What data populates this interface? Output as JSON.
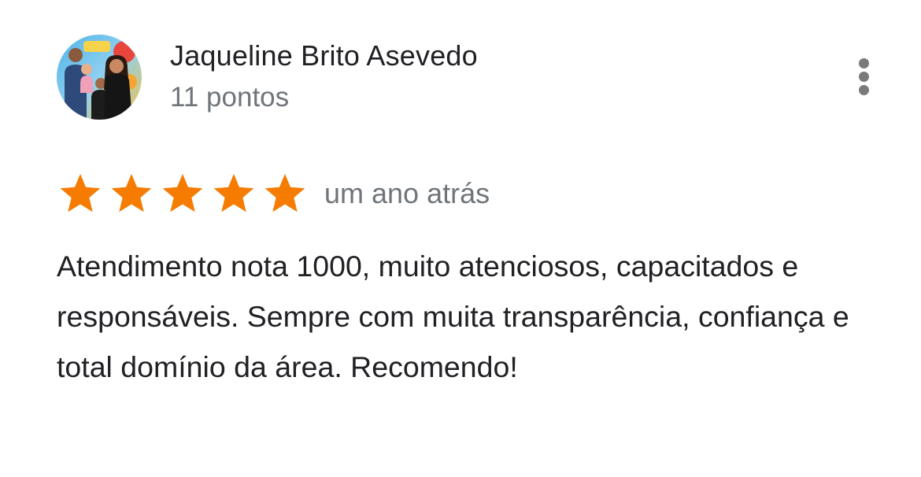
{
  "review": {
    "reviewer_name": "Jaqueline Brito Asevedo",
    "reviewer_points": "11 pontos",
    "rating": 5,
    "rating_max": 5,
    "date": "um ano atrás",
    "text": "Atendimento nota 1000, muito atenciosos, capacitados e responsáveis. Sempre com muita transparência, confiança e total domínio da área. Recomendo!"
  },
  "icons": {
    "star": "star-icon",
    "more": "more-vert-icon",
    "avatar": "avatar-photo"
  },
  "colors": {
    "star": "#f57c00",
    "name": "#202124",
    "secondary": "#70757a",
    "body_text": "#202124",
    "menu_dots": "#7a7a7a"
  }
}
